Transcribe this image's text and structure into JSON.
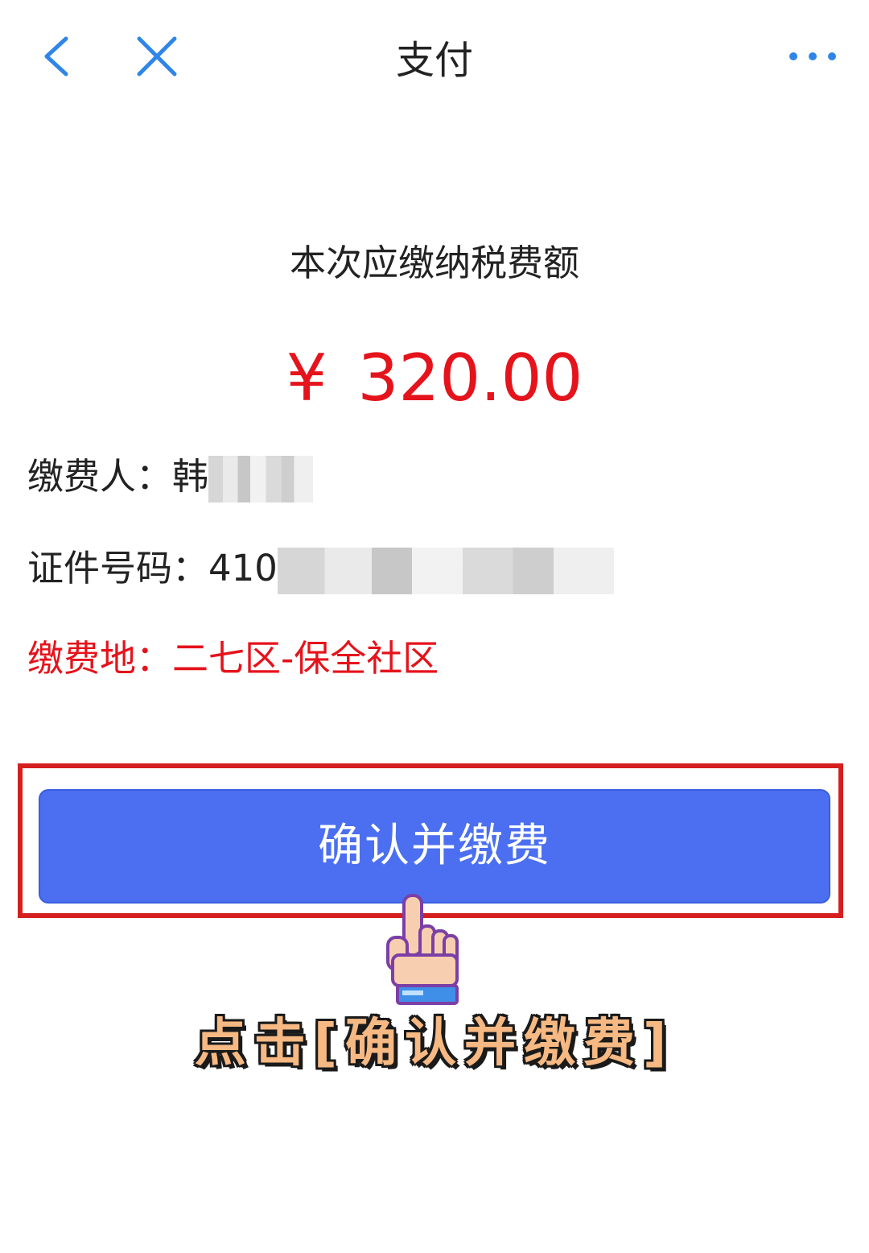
{
  "header": {
    "title": "支付",
    "back_icon": "chevron-left-icon",
    "close_icon": "close-icon",
    "more_icon": "more-dots-icon",
    "icon_color": "#2f86e8"
  },
  "payment": {
    "subtitle": "本次应缴纳税费额",
    "currency": "¥",
    "amount": "320.00",
    "amount_color": "#e5131b"
  },
  "details": {
    "payer_label": "缴费人：",
    "payer_value": "韩",
    "id_label": "证件号码：",
    "id_value": "410",
    "place_label": "缴费地：",
    "place_value": "二七区-保全社区"
  },
  "action": {
    "confirm_label": "确认并缴费",
    "button_color": "#4b6ff0",
    "highlight_color": "#d51f1f"
  },
  "annotation": {
    "hint": "点击[确认并缴费]",
    "hand_icon": "pointing-hand-icon"
  }
}
